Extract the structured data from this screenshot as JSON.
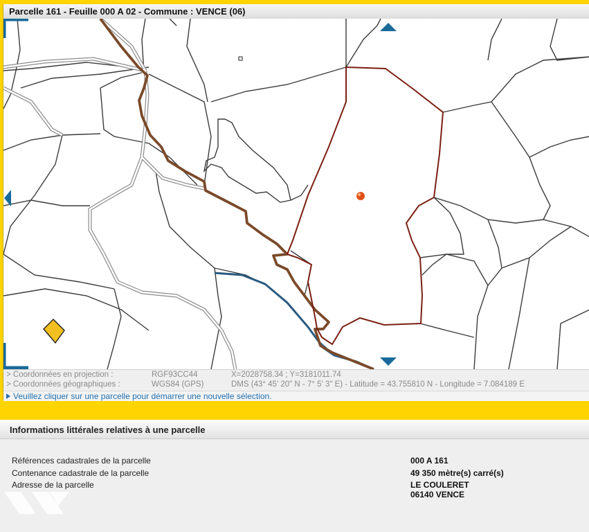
{
  "map_window": {
    "title": "Parcelle 161 - Feuille 000 A 02 - Commune : VENCE (06)"
  },
  "coordinates": {
    "projection_label": "> Coordonnées en projection :",
    "projection_system": "RGF93CC44",
    "projection_value": "X=2028758.34 ; Y=3181011.74",
    "geographic_label": "> Coordonnées géographiques :",
    "geographic_system": "WGS84 (GPS)",
    "geographic_value": "DMS (43° 45' 20\" N - 7° 5' 3\" E) - Latitude = 43.755810 N - Longitude = 7.084189 E"
  },
  "message": "Veuillez cliquer sur une parcelle pour démarrer une nouvelle sélection.",
  "info_panel": {
    "title": "Informations littérales relatives à une parcelle",
    "rows": [
      {
        "label": "Références cadastrales de la parcelle",
        "value": "000 A 161"
      },
      {
        "label": "Contenance cadastrale de la parcelle",
        "value": "49 350 mètre(s) carré(s)"
      },
      {
        "label": "Adresse de la parcelle",
        "value": "LE COULERET",
        "value2": "06140 VENCE"
      }
    ]
  },
  "colors": {
    "accent_yellow": "#ffd400",
    "selected_parcel": "#7a1f12",
    "path_brown": "#7a4a2a",
    "river_blue": "#2a5a80",
    "nav_arrow": "#1a6a9a",
    "marker": "#e0501a",
    "building": "#f2c020"
  },
  "icons": {
    "nav_up": "triangle-up-icon",
    "nav_down": "triangle-down-icon",
    "nav_left": "triangle-left-icon",
    "location_marker": "location-dot-icon"
  }
}
